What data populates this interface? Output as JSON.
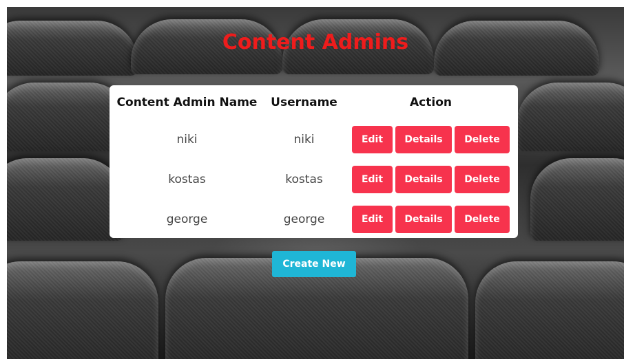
{
  "page": {
    "title": "Content Admins"
  },
  "table": {
    "headers": [
      "Content Admin Name",
      "Username",
      "Action"
    ],
    "rows": [
      {
        "name": "niki",
        "username": "niki"
      },
      {
        "name": "kostas",
        "username": "kostas"
      },
      {
        "name": "george",
        "username": "george"
      }
    ],
    "actions": {
      "edit": "Edit",
      "details": "Details",
      "delete": "Delete"
    }
  },
  "buttons": {
    "create_new": "Create New"
  },
  "colors": {
    "title": "#ee1c1c",
    "action_button": "#f7334d",
    "create_button": "#1fb6d6"
  }
}
